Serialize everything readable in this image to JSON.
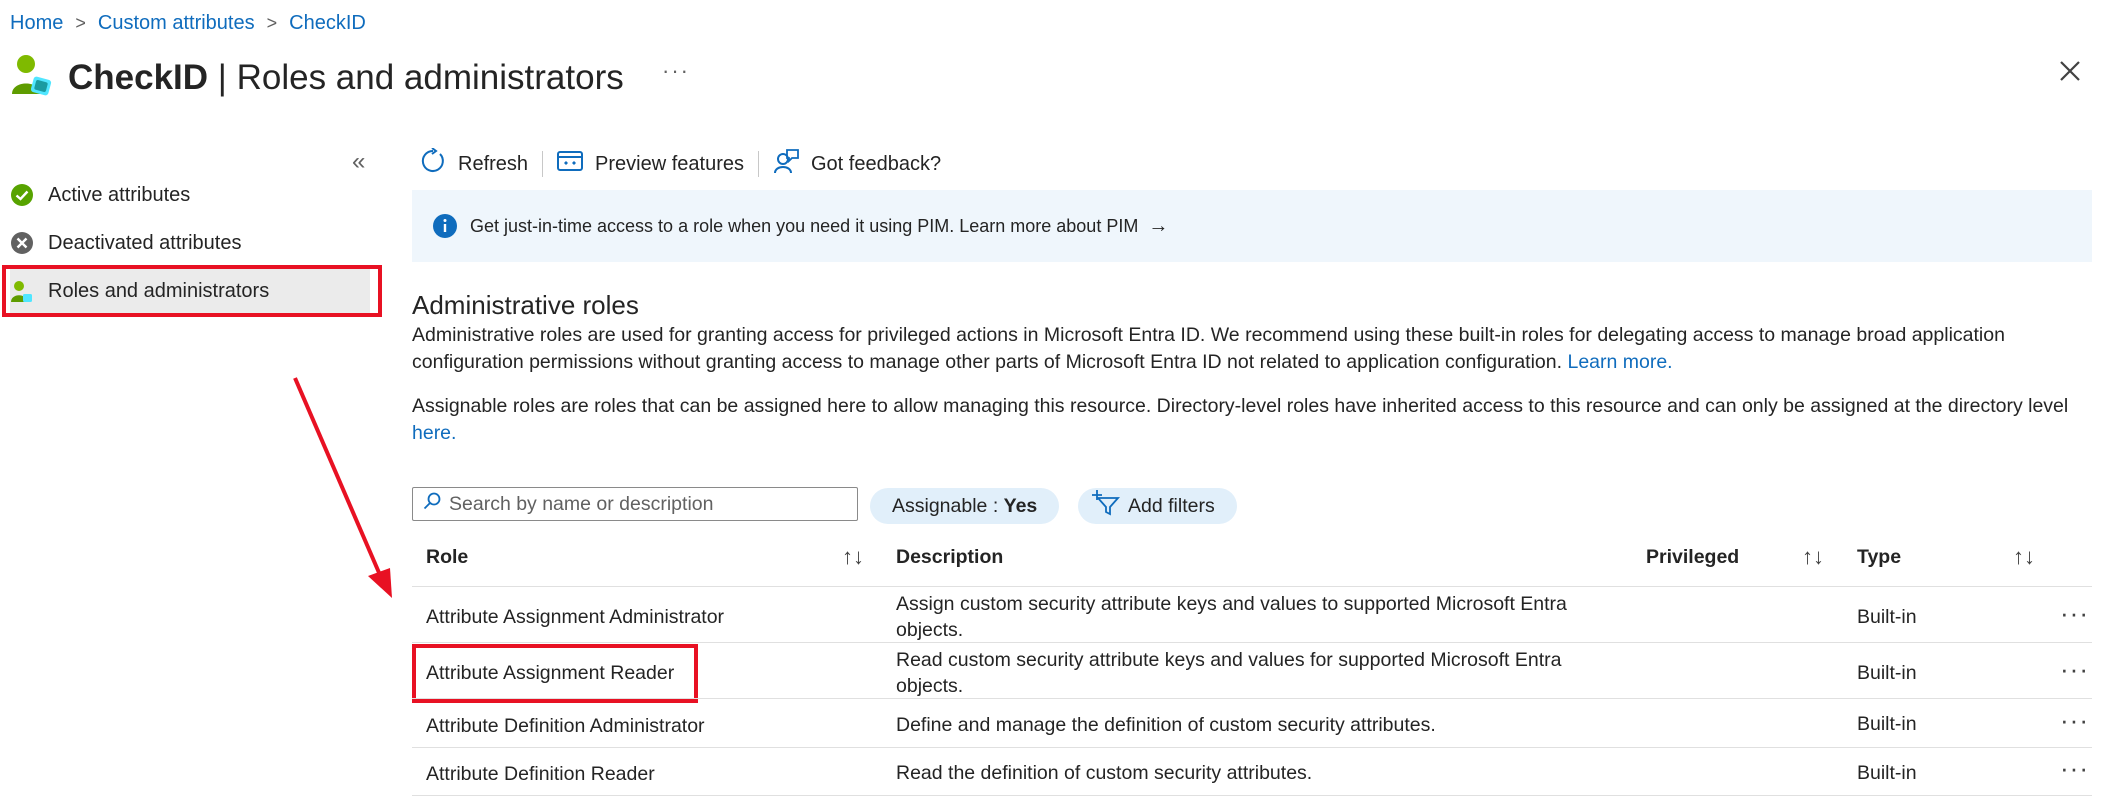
{
  "breadcrumb": {
    "home": "Home",
    "custom_attributes": "Custom attributes",
    "checkid": "CheckID",
    "separator": ">"
  },
  "header": {
    "title_bold": "CheckID",
    "title_rest": " | Roles and administrators",
    "more": "···"
  },
  "sidebar": {
    "collapse": "«",
    "items": [
      {
        "label": "Active attributes",
        "icon": "check-circle-icon"
      },
      {
        "label": "Deactivated attributes",
        "icon": "x-circle-icon"
      },
      {
        "label": "Roles and administrators",
        "icon": "user-admin-icon"
      }
    ]
  },
  "toolbar": {
    "refresh": "Refresh",
    "preview": "Preview features",
    "feedback": "Got feedback?"
  },
  "banner": {
    "text": "Get just-in-time access to a role when you need it using PIM. Learn more about PIM",
    "arrow": "→"
  },
  "section": {
    "title": "Administrative roles",
    "para1": "Administrative roles are used for granting access for privileged actions in Microsoft Entra ID. We recommend using these built-in roles for delegating access to manage broad application configuration permissions without granting access to manage other parts of Microsoft Entra ID not related to application configuration.",
    "para1_link": "Learn more.",
    "para2": "Assignable roles are roles that can be assigned here to allow managing this resource. Directory-level roles have inherited access to this resource and can only be assigned at the directory level",
    "para2_link": "here."
  },
  "filters": {
    "search_placeholder": "Search by name or description",
    "assignable_label": "Assignable : ",
    "assignable_value": "Yes",
    "add_filters": "Add filters"
  },
  "table": {
    "headers": {
      "role": "Role",
      "description": "Description",
      "privileged": "Privileged",
      "type": "Type"
    },
    "sort_glyph": "↑↓",
    "rows": [
      {
        "role": "Attribute Assignment Administrator",
        "description": "Assign custom security attribute keys and values to supported Microsoft Entra objects.",
        "type": "Built-in"
      },
      {
        "role": "Attribute Assignment Reader",
        "description": "Read custom security attribute keys and values for supported Microsoft Entra objects.",
        "type": "Built-in"
      },
      {
        "role": "Attribute Definition Administrator",
        "description": "Define and manage the definition of custom security attributes.",
        "type": "Built-in"
      },
      {
        "role": "Attribute Definition Reader",
        "description": "Read the definition of custom security attributes.",
        "type": "Built-in"
      }
    ],
    "row_more": "···"
  },
  "colors": {
    "accent": "#0f6cbd",
    "highlight": "#e81123",
    "banner_bg": "#eff6fc",
    "pill_bg": "#e1effa"
  }
}
